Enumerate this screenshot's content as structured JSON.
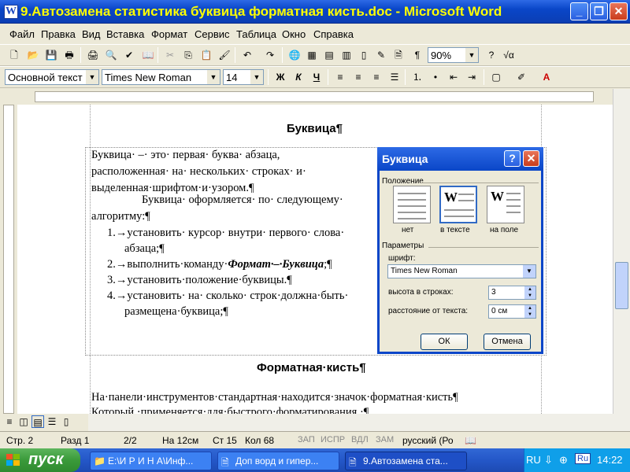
{
  "window": {
    "title": "9.Автозамена статистика буквица форматная кисть.doc - Microsoft Word",
    "icon_letter": "W",
    "min": "_",
    "max": "❐",
    "close": "✕"
  },
  "menu": [
    "Файл",
    "Правка",
    "Вид",
    "Вставка",
    "Формат",
    "Сервис",
    "Таблица",
    "Окно",
    "Справка"
  ],
  "toolbar": {
    "zoom": "90%"
  },
  "format_toolbar": {
    "style": "Основной текст",
    "font": "Times New Roman",
    "size": "14",
    "bold": "Ж",
    "italic": "К",
    "underline": "Ч"
  },
  "document": {
    "heading1": "Буквица¶",
    "p1": [
      "Буквица· –· это· первая· буква· абзаца,",
      "расположенная· на· нескольких· строках· и·",
      "выделенная·шрифтом·и·узором.¶"
    ],
    "p2": [
      "Буквица· оформляется· по· следующему·",
      "алгоритму:¶"
    ],
    "items": [
      {
        "n": "1.→",
        "t": "установить· курсор· внутри· первого· слова·",
        "t2": "абзаца;¶"
      },
      {
        "n": "2.→",
        "t": "выполнить·команду·",
        "b": "Формат·–·Буквица",
        "t3": ";¶"
      },
      {
        "n": "3.→",
        "t": "установить·положение·буквицы.¶"
      },
      {
        "n": "4.→",
        "t": "установить· на· сколько· строк·должна·быть·",
        "t2": "размещена·буквица;¶"
      }
    ],
    "heading2": "Форматная·кисть¶",
    "p3": "На·панели·инструментов·стандартная·находится·значок·форматная·кисть¶",
    "p4": "Который,·применяется·для·быстрого·форматирования.·¶"
  },
  "dialog": {
    "title": "Буквица",
    "help": "?",
    "close": "✕",
    "position_label": "Положение",
    "pos_none": "нет",
    "pos_text": "в тексте",
    "pos_margin": "на поле",
    "params_label": "Параметры",
    "font_label": "шрифт:",
    "font_value": "Times New Roman",
    "lines_label": "высота в строках:",
    "lines_value": "3",
    "dist_label": "расстояние от текста:",
    "dist_value": "0 см",
    "ok": "ОК",
    "cancel": "Отмена"
  },
  "status": {
    "page": "Стр. 2",
    "section": "Разд 1",
    "pages": "2/2",
    "at": "На 12см",
    "line": "Ст 15",
    "col": "Кол 68",
    "rec": "ЗАП",
    "trk": "ИСПР",
    "ext": "ВДЛ",
    "ovr": "ЗАМ",
    "lang": "русский (Ро"
  },
  "taskbar": {
    "start": "пуск",
    "tasks": [
      "E:\\И Р И Н А\\Инф...",
      "Доп ворд и гипер...",
      "9.Автозамена ста..."
    ],
    "lang": "RU",
    "tray_lang": "Ru",
    "clock": "14:22"
  }
}
